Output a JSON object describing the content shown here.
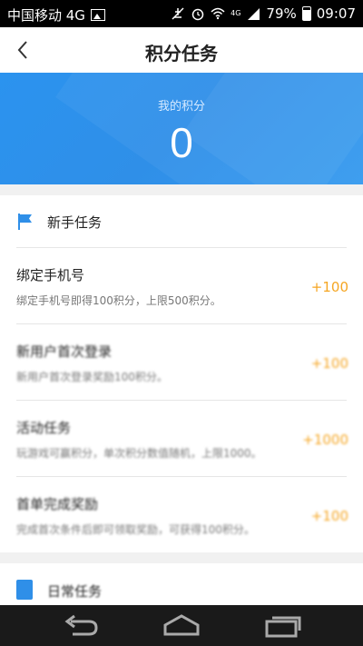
{
  "status_bar": {
    "carrier": "中国移动 4G",
    "signal_type": "4G",
    "battery": "79%",
    "time": "09:07"
  },
  "header": {
    "title": "积分任务"
  },
  "banner": {
    "label": "我的积分",
    "value": "0"
  },
  "sections": [
    {
      "name": "新手任务",
      "tasks": [
        {
          "title": "绑定手机号",
          "desc": "绑定手机号即得100积分，上限500积分。",
          "points": "+100"
        },
        {
          "title": "新用户首次登录",
          "desc": "新用户首次登录奖励100积分。",
          "points": "+100"
        },
        {
          "title": "活动任务",
          "desc": "玩游戏可赢积分，单次积分数值随机，上限1000。",
          "points": "+1000"
        },
        {
          "title": "首单完成奖励",
          "desc": "完成首次条件后即可领取奖励，可获得100积分。",
          "points": "+100"
        }
      ]
    },
    {
      "name": "日常任务"
    }
  ],
  "colors": {
    "accent": "#2f8fe8",
    "points": "#f5a623"
  },
  "nav": {
    "back_icon": "back-arrow-icon",
    "home_icon": "home-icon",
    "recents_icon": "recent-apps-icon"
  }
}
